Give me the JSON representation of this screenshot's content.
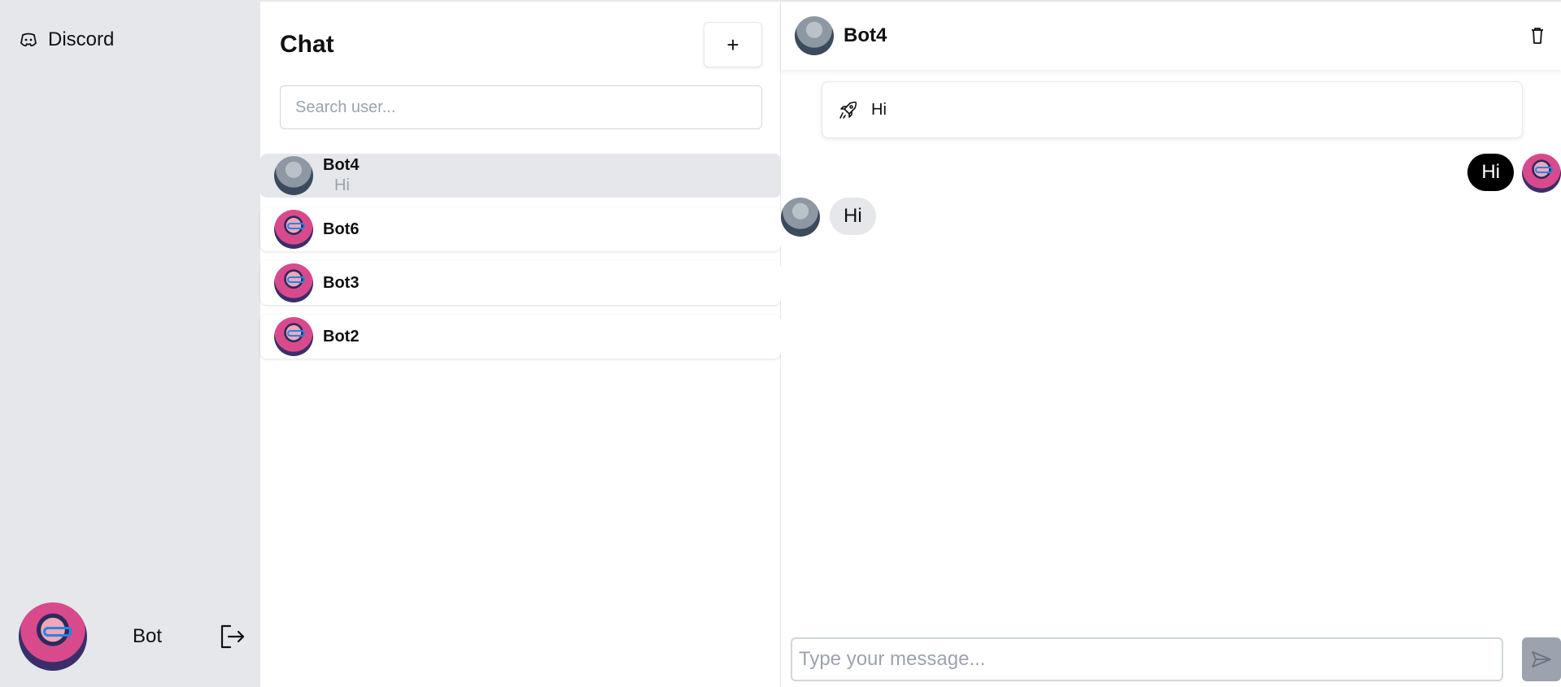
{
  "sidebar": {
    "brand_label": "Discord",
    "brand_icon": "discord-icon",
    "profile": {
      "name": "Bot",
      "logout_icon": "logout-icon"
    }
  },
  "chat_list": {
    "title": "Chat",
    "new_chat_label": "+",
    "search_placeholder": "Search user...",
    "conversations": [
      {
        "name": "Bot4",
        "preview": "Hi",
        "active": true,
        "avatar": "polar-bear-avatar"
      },
      {
        "name": "Bot6",
        "preview": "",
        "active": false,
        "avatar": "cartoon-avatar"
      },
      {
        "name": "Bot3",
        "preview": "",
        "active": false,
        "avatar": "cartoon-avatar"
      },
      {
        "name": "Bot2",
        "preview": "",
        "active": false,
        "avatar": "cartoon-avatar"
      }
    ]
  },
  "conversation": {
    "header_name": "Bot4",
    "delete_icon": "trash-icon",
    "notice": {
      "icon": "rocket-icon",
      "text": "Hi"
    },
    "messages": [
      {
        "direction": "outgoing",
        "text": "Hi"
      },
      {
        "direction": "incoming",
        "text": "Hi"
      }
    ],
    "composer_placeholder": "Type your message...",
    "send_icon": "send-icon"
  },
  "colors": {
    "sidebar_bg": "#e5e7eb",
    "outgoing_bubble": "#000000",
    "incoming_bubble": "#e5e7eb",
    "send_button": "#9ca3af"
  }
}
